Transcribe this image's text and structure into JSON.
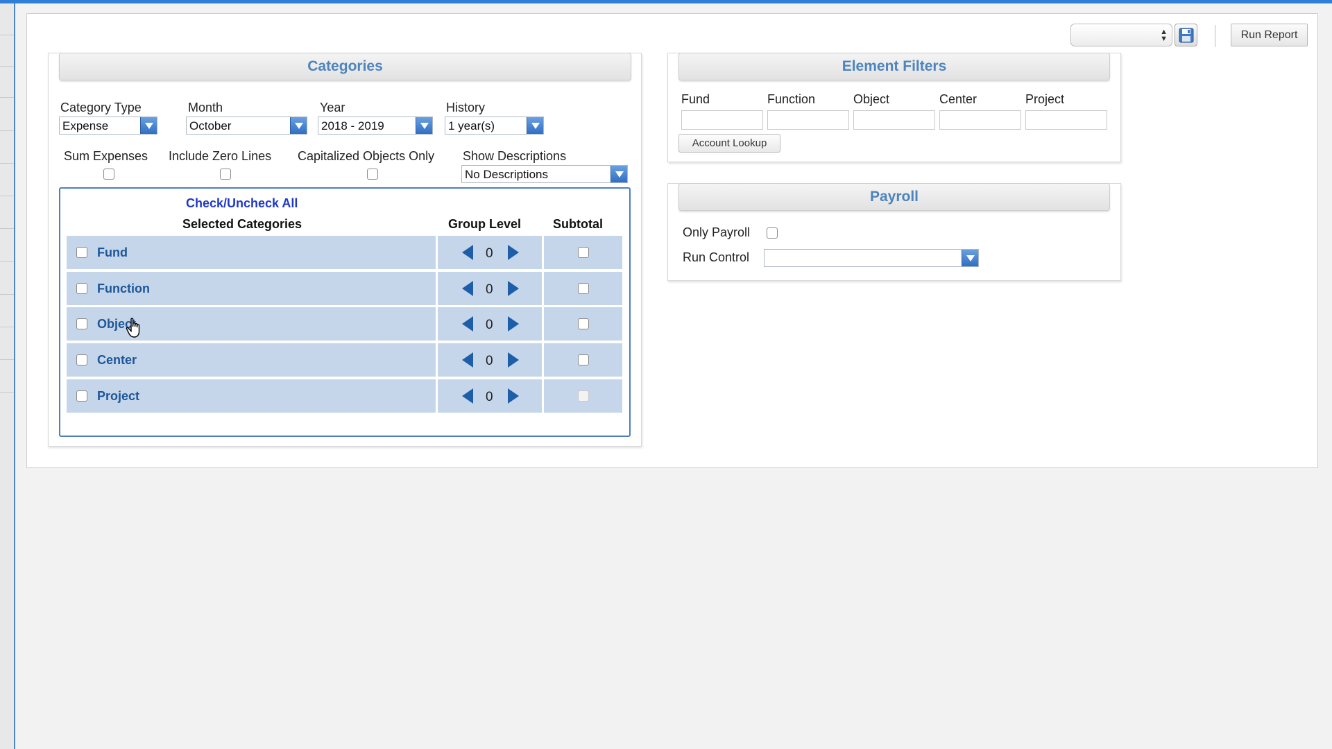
{
  "toolbar": {
    "report_select_value": "",
    "save_icon": "save-icon",
    "run_report_label": "Run Report"
  },
  "categories": {
    "title": "Categories",
    "category_type": {
      "label": "Category Type",
      "value": "Expense"
    },
    "month": {
      "label": "Month",
      "value": "October"
    },
    "year": {
      "label": "Year",
      "value": "2018 - 2019"
    },
    "history": {
      "label": "History",
      "value": "1 year(s)"
    },
    "sum_expenses": {
      "label": "Sum Expenses",
      "checked": false
    },
    "include_zero_lines": {
      "label": "Include Zero Lines",
      "checked": false
    },
    "capitalized_objects_only": {
      "label": "Capitalized Objects Only",
      "checked": false
    },
    "show_descriptions": {
      "label": "Show Descriptions",
      "value": "No Descriptions"
    },
    "check_all_label": "Check/Uncheck All",
    "columns": {
      "selected": "Selected Categories",
      "group_level": "Group Level",
      "subtotal": "Subtotal"
    },
    "rows": [
      {
        "label": "Fund",
        "level": "0",
        "checked": false,
        "subtotal": false
      },
      {
        "label": "Function",
        "level": "0",
        "checked": false,
        "subtotal": false
      },
      {
        "label": "Object",
        "level": "0",
        "checked": false,
        "subtotal": false
      },
      {
        "label": "Center",
        "level": "0",
        "checked": false,
        "subtotal": false
      },
      {
        "label": "Project",
        "level": "0",
        "checked": false,
        "subtotal": false,
        "subtotal_disabled": true
      }
    ]
  },
  "element_filters": {
    "title": "Element Filters",
    "fields": [
      "Fund",
      "Function",
      "Object",
      "Center",
      "Project"
    ],
    "account_lookup_label": "Account Lookup"
  },
  "payroll": {
    "title": "Payroll",
    "only_payroll_label": "Only Payroll",
    "only_payroll_checked": false,
    "run_control_label": "Run Control",
    "run_control_value": ""
  },
  "colors": {
    "accent": "#2f7fd6",
    "header_text": "#4d84bd",
    "row_fill": "#c6d6ea",
    "row_text": "#1c5698",
    "link": "#1f39c5"
  }
}
